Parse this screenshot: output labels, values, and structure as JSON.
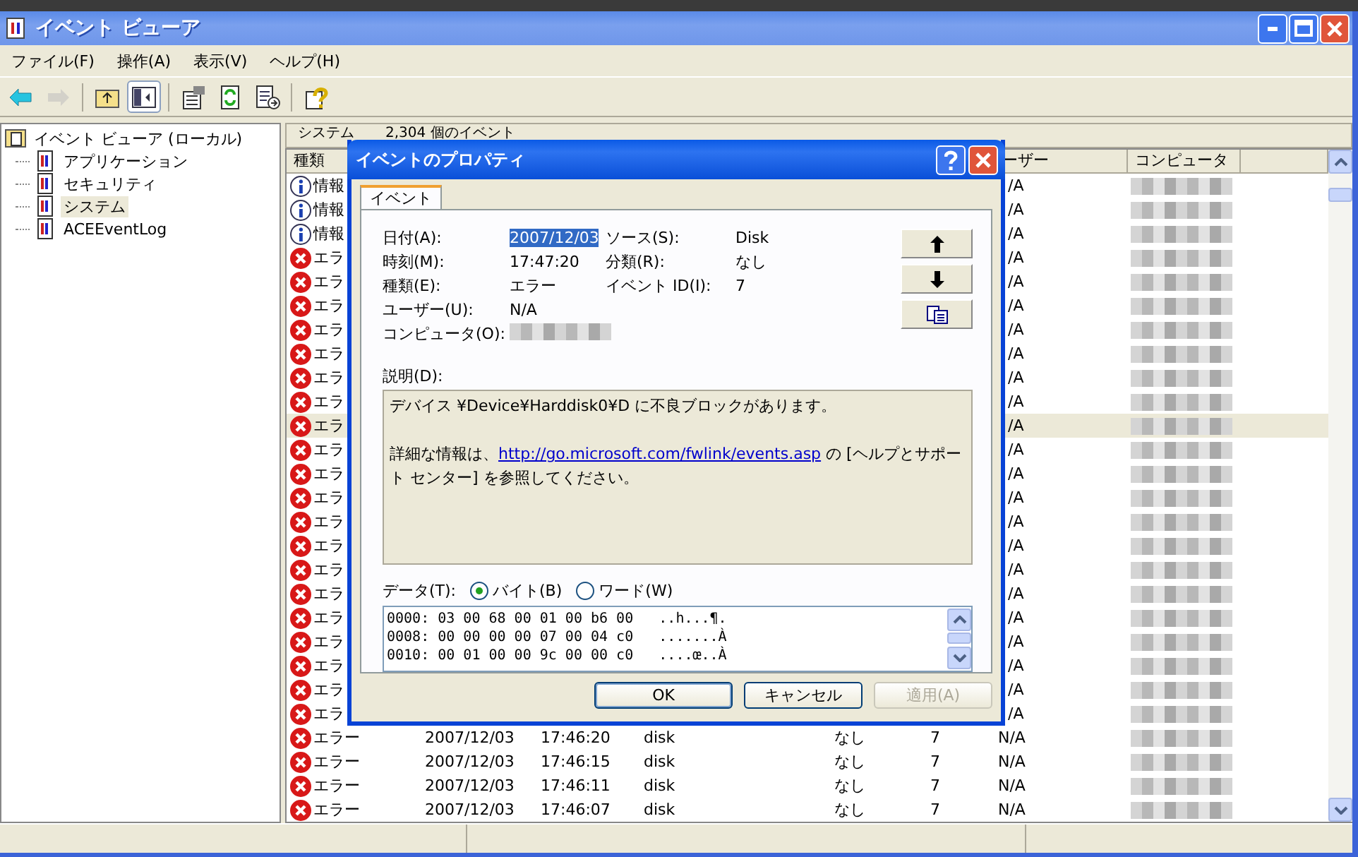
{
  "window": {
    "title": "イベント ビューア"
  },
  "menu": [
    {
      "label": "ファイル(F)"
    },
    {
      "label": "操作(A)"
    },
    {
      "label": "表示(V)"
    },
    {
      "label": "ヘルプ(H)"
    }
  ],
  "toolbar": [
    {
      "kind": "back",
      "disabled": false
    },
    {
      "kind": "forward",
      "disabled": true
    },
    {
      "kind": "separator"
    },
    {
      "kind": "up",
      "disabled": false
    },
    {
      "kind": "tree",
      "disabled": false,
      "pressed": true
    },
    {
      "kind": "separator"
    },
    {
      "kind": "properties",
      "disabled": false
    },
    {
      "kind": "refresh",
      "disabled": false
    },
    {
      "kind": "export",
      "disabled": false
    },
    {
      "kind": "separator"
    },
    {
      "kind": "help",
      "disabled": false
    }
  ],
  "tree": {
    "label": "イベント ビューア (ローカル)",
    "children": [
      {
        "label": "アプリケーション",
        "selected": false
      },
      {
        "label": "セキュリティ",
        "selected": false
      },
      {
        "label": "システム",
        "selected": true
      },
      {
        "label": "ACEEventLog",
        "selected": false
      }
    ]
  },
  "list": {
    "title": "システム",
    "count": "2,304 個のイベント",
    "type_header": "種類",
    "user_header": "ーザー",
    "computer_header": "コンピュータ",
    "rows": [
      {
        "kind": "info",
        "type": "情報",
        "user": "/A",
        "selected": false
      },
      {
        "kind": "info",
        "type": "情報",
        "user": "/A",
        "selected": false
      },
      {
        "kind": "info",
        "type": "情報",
        "user": "/A",
        "selected": false
      },
      {
        "kind": "error",
        "type": "エラ",
        "user": "/A",
        "selected": false
      },
      {
        "kind": "error",
        "type": "エラ",
        "user": "/A",
        "selected": false
      },
      {
        "kind": "error",
        "type": "エラ",
        "user": "/A",
        "selected": false
      },
      {
        "kind": "error",
        "type": "エラ",
        "user": "/A",
        "selected": false
      },
      {
        "kind": "error",
        "type": "エラ",
        "user": "/A",
        "selected": false
      },
      {
        "kind": "error",
        "type": "エラ",
        "user": "/A",
        "selected": false
      },
      {
        "kind": "error",
        "type": "エラ",
        "user": "/A",
        "selected": false
      },
      {
        "kind": "error",
        "type": "エラ",
        "user": "/A",
        "selected": true
      },
      {
        "kind": "error",
        "type": "エラ",
        "user": "/A",
        "selected": false
      },
      {
        "kind": "error",
        "type": "エラ",
        "user": "/A",
        "selected": false
      },
      {
        "kind": "error",
        "type": "エラ",
        "user": "/A",
        "selected": false
      },
      {
        "kind": "error",
        "type": "エラ",
        "user": "/A",
        "selected": false
      },
      {
        "kind": "error",
        "type": "エラ",
        "user": "/A",
        "selected": false
      },
      {
        "kind": "error",
        "type": "エラ",
        "user": "/A",
        "selected": false
      },
      {
        "kind": "error",
        "type": "エラ",
        "user": "/A",
        "selected": false
      },
      {
        "kind": "error",
        "type": "エラ",
        "user": "/A",
        "selected": false
      },
      {
        "kind": "error",
        "type": "エラ",
        "user": "/A",
        "selected": false
      },
      {
        "kind": "error",
        "type": "エラ",
        "user": "/A",
        "selected": false
      },
      {
        "kind": "error",
        "type": "エラ",
        "user": "/A",
        "selected": false
      },
      {
        "kind": "error",
        "type": "エラ",
        "user": "/A",
        "selected": false
      },
      {
        "kind": "error",
        "type": "エラー",
        "date": "2007/12/03",
        "time": "17:46:20",
        "source": "disk",
        "category": "なし",
        "event": "7",
        "user": "N/A",
        "selected": false
      },
      {
        "kind": "error",
        "type": "エラー",
        "date": "2007/12/03",
        "time": "17:46:15",
        "source": "disk",
        "category": "なし",
        "event": "7",
        "user": "N/A",
        "selected": false
      },
      {
        "kind": "error",
        "type": "エラー",
        "date": "2007/12/03",
        "time": "17:46:11",
        "source": "disk",
        "category": "なし",
        "event": "7",
        "user": "N/A",
        "selected": false
      },
      {
        "kind": "error",
        "type": "エラー",
        "date": "2007/12/03",
        "time": "17:46:07",
        "source": "disk",
        "category": "なし",
        "event": "7",
        "user": "N/A",
        "selected": false
      }
    ]
  },
  "dialog": {
    "title": "イベントのプロパティ",
    "tab": "イベント",
    "left_fields": [
      {
        "label": "日付(A):",
        "value": "2007/12/03",
        "highlighted": true
      },
      {
        "label": "時刻(M):",
        "value": "17:47:20",
        "highlighted": false
      },
      {
        "label": "種類(E):",
        "value": "エラー",
        "highlighted": false
      },
      {
        "label": "ユーザー(U):",
        "value": "N/A",
        "highlighted": false
      },
      {
        "label": "コンピュータ(O):",
        "kind": "redacted"
      }
    ],
    "right_fields": [
      {
        "label": "ソース(S):",
        "value": "Disk"
      },
      {
        "label": "分類(R):",
        "value": "なし"
      },
      {
        "label": "イベント ID(I):",
        "value": "7"
      }
    ],
    "description_label": "説明(D):",
    "description": [
      {
        "text": "デバイス ¥Device¥Harddisk0¥D に不良ブロックがあります。"
      },
      {
        "before": "詳細な情報は、",
        "link": "http://go.microsoft.com/fwlink/events.asp",
        "after": " の [ヘルプとサポート センター] を参照してください。"
      }
    ],
    "data_label": "データ(T):",
    "radios": [
      {
        "label": "バイト(B)",
        "selected": true
      },
      {
        "label": "ワード(W)",
        "selected": false
      }
    ],
    "hex_lines": [
      "0000: 03 00 68 00 01 00 b6 00   ..h...¶.",
      "0008: 00 00 00 00 07 00 04 c0   .......À",
      "0010: 00 01 00 00 9c 00 00 c0   ....œ..À"
    ],
    "buttons": [
      {
        "label": "OK",
        "default": true,
        "disabled": false
      },
      {
        "label": "キャンセル",
        "default": false,
        "disabled": false
      },
      {
        "label": "適用(A)",
        "default": false,
        "disabled": true
      }
    ]
  }
}
